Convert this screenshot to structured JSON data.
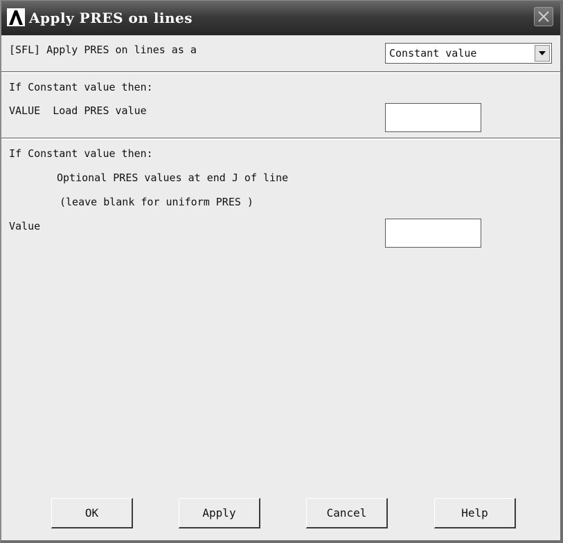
{
  "window": {
    "title": "Apply PRES on lines"
  },
  "section1": {
    "label": "[SFL] Apply PRES on lines as a",
    "dropdown_value": "Constant value"
  },
  "section2": {
    "condition": "If Constant value then:",
    "field_label": "VALUE  Load PRES value",
    "field_value": ""
  },
  "section3": {
    "condition": "If Constant value then:",
    "note1": "Optional PRES values at end J of line",
    "note2": "(leave blank for uniform PRES )",
    "field_label": "Value",
    "field_value": ""
  },
  "buttons": {
    "ok": "OK",
    "apply": "Apply",
    "cancel": "Cancel",
    "help": "Help"
  },
  "icons": {
    "logo": "ansys-logo-icon",
    "close": "close-icon",
    "dropdown": "chevron-down-icon"
  }
}
